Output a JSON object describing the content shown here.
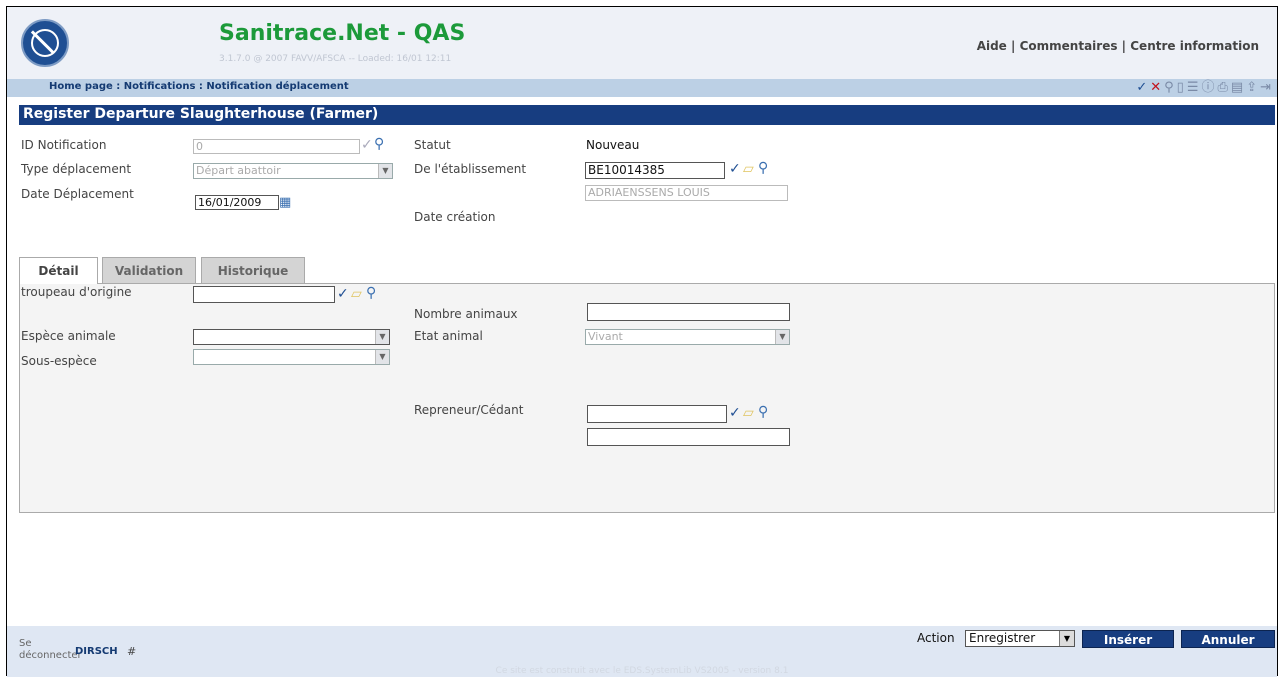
{
  "app": {
    "title": "Sanitrace.Net - QAS",
    "version": "3.1.7.0 @ 2007 FAVV/AFSCA -- Loaded: 16/01 12:11",
    "links": [
      "Aide",
      "Commentaires",
      "Centre information"
    ],
    "separator": "|"
  },
  "breadcrumb": "Home page : Notifications : Notification déplacement",
  "toolbar_icons": [
    "check-icon",
    "x-icon",
    "search-icon",
    "document-icon",
    "list-icon",
    "info-icon",
    "print-icon",
    "save-icon",
    "export-icon",
    "exit-icon"
  ],
  "page_title": "Register Departure Slaughterhouse (Farmer)",
  "header_form": {
    "id_notification": {
      "label": "ID Notification",
      "value": "0"
    },
    "type_deplacement": {
      "label": "Type déplacement",
      "value": "Départ abattoir"
    },
    "date_deplacement": {
      "label": "Date Déplacement",
      "value": "16/01/2009"
    },
    "statut": {
      "label": "Statut",
      "value": "Nouveau"
    },
    "etablissement": {
      "label": "De l'établissement",
      "value": "BE10014385",
      "name": "ADRIAENSSENS LOUIS"
    },
    "date_creation": {
      "label": "Date création",
      "value": ""
    }
  },
  "tabs": [
    {
      "label": "Détail",
      "active": true
    },
    {
      "label": "Validation",
      "active": false
    },
    {
      "label": "Historique",
      "active": false
    }
  ],
  "detail": {
    "troupeau": {
      "label": "troupeau d'origine",
      "value": ""
    },
    "nombre_animaux": {
      "label": "Nombre animaux",
      "value": ""
    },
    "espece": {
      "label": "Espèce animale",
      "value": ""
    },
    "etat_animal": {
      "label": "Etat animal",
      "value": "Vivant"
    },
    "sous_espece": {
      "label": "Sous-espèce",
      "value": ""
    },
    "repreneur": {
      "label": "Repreneur/Cédant",
      "value": "",
      "name": ""
    }
  },
  "footer": {
    "logout": "Se déconnecter",
    "user": "DIRSCH",
    "hash": "#",
    "action_label": "Action",
    "action_value": "Enregistrer",
    "insert_button": "Insérer",
    "cancel_button": "Annuler",
    "credit": "Ce site est construit avec le EDS.SystemLib VS2005 - version 8.1"
  },
  "colors": {
    "title_green": "#1c9a3a",
    "title_bar": "#173d80",
    "header_bg": "#eef1f7",
    "breadcrumb_bg": "#bcd0e5"
  }
}
